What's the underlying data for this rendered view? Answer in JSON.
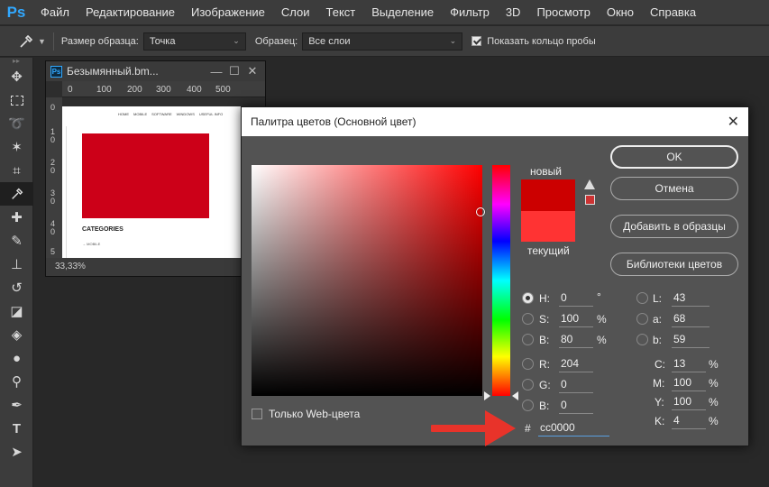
{
  "app": {
    "logo": "Ps"
  },
  "menu": [
    "Файл",
    "Редактирование",
    "Изображение",
    "Слои",
    "Текст",
    "Выделение",
    "Фильтр",
    "3D",
    "Просмотр",
    "Окно",
    "Справка"
  ],
  "options": {
    "sample_size_label": "Размер образца:",
    "sample_size_value": "Точка",
    "sample_label": "Образец:",
    "sample_value": "Все слои",
    "show_ring_label": "Показать кольцо пробы",
    "show_ring_checked": true
  },
  "document": {
    "title": "Безымянный.bm...",
    "ruler_ticks": [
      "0",
      "100",
      "200",
      "300",
      "400",
      "500"
    ],
    "ruler_v_ticks": [
      "0",
      "1 0",
      "2 0",
      "3 0",
      "4 0",
      "5"
    ],
    "zoom": "33,33%",
    "page_nav": [
      "HOME",
      "MOBILE",
      "SOFTWARE",
      "WINDOWS",
      "USEFUL INFO"
    ],
    "page_heading": "CATEGORIES",
    "page_link": "MOBILE"
  },
  "dialog": {
    "title": "Палитра цветов (Основной цвет)",
    "new_label": "новый",
    "current_label": "текущий",
    "new_color": "#cc0000",
    "current_color": "#ff3333",
    "buttons": {
      "ok": "OK",
      "cancel": "Отмена",
      "add": "Добавить в образцы",
      "libraries": "Библиотеки цветов"
    },
    "web_only_label": "Только Web-цвета",
    "hsb": [
      {
        "label": "H:",
        "value": "0",
        "unit": "°",
        "selected": true
      },
      {
        "label": "S:",
        "value": "100",
        "unit": "%",
        "selected": false
      },
      {
        "label": "B:",
        "value": "80",
        "unit": "%",
        "selected": false
      }
    ],
    "rgb": [
      {
        "label": "R:",
        "value": "204"
      },
      {
        "label": "G:",
        "value": "0"
      },
      {
        "label": "B:",
        "value": "0"
      }
    ],
    "lab": [
      {
        "label": "L:",
        "value": "43"
      },
      {
        "label": "a:",
        "value": "68"
      },
      {
        "label": "b:",
        "value": "59"
      }
    ],
    "cmyk": [
      {
        "label": "C:",
        "value": "13",
        "unit": "%"
      },
      {
        "label": "M:",
        "value": "100",
        "unit": "%"
      },
      {
        "label": "Y:",
        "value": "100",
        "unit": "%"
      },
      {
        "label": "K:",
        "value": "4",
        "unit": "%"
      }
    ],
    "hex_label": "#",
    "hex_value": "cc0000"
  },
  "arrow_color": "#e8332a"
}
